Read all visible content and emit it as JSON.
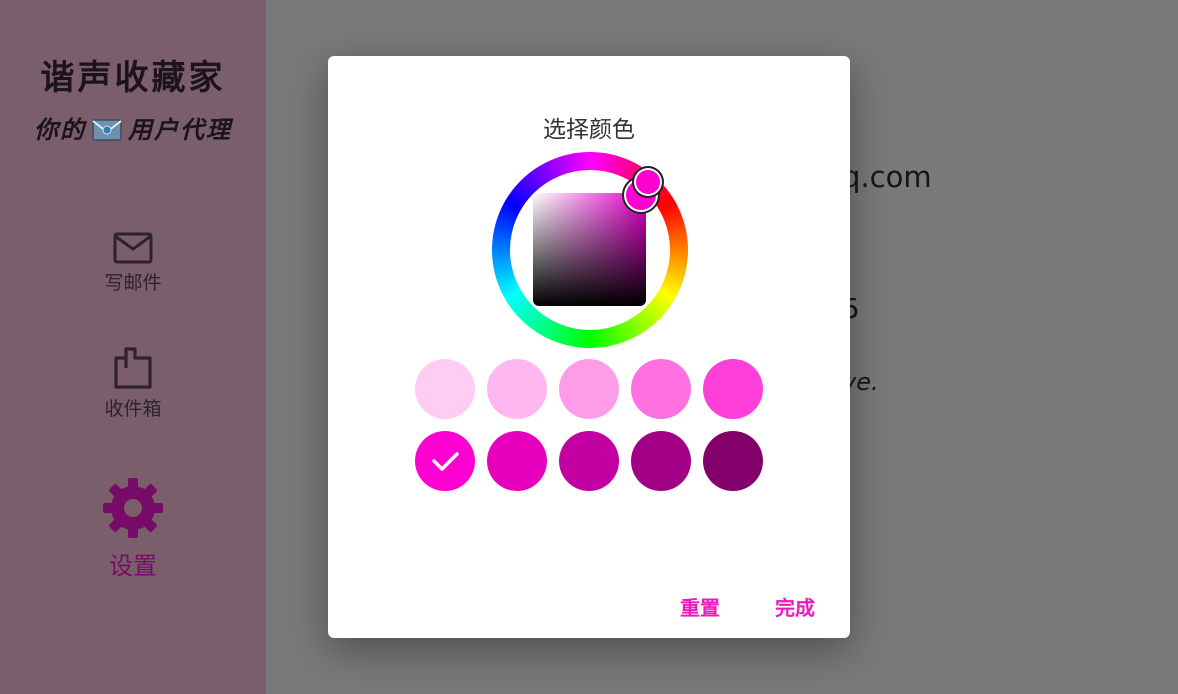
{
  "sidebar": {
    "app_title": "谐声收藏家",
    "subtitle_prefix": "你的",
    "subtitle_suffix": "用户代理",
    "items": [
      {
        "label": "写邮件",
        "icon": "mail-icon"
      },
      {
        "label": "收件箱",
        "icon": "inbox-icon"
      },
      {
        "label": "设置",
        "icon": "gear-icon",
        "active": true
      }
    ]
  },
  "background": {
    "email_fragment": "q.com",
    "number_fragment": "5",
    "note_fragment": "ve."
  },
  "dialog": {
    "title": "选择颜色",
    "selected_color": "#ff00d2",
    "swatches": [
      {
        "color": "#ffcdf4"
      },
      {
        "color": "#ffb8ef"
      },
      {
        "color": "#ff9ce8"
      },
      {
        "color": "#ff70e0"
      },
      {
        "color": "#ff3fd9"
      },
      {
        "color": "#ff00d2",
        "selected": true
      },
      {
        "color": "#e600bd"
      },
      {
        "color": "#c300a1"
      },
      {
        "color": "#a20086"
      },
      {
        "color": "#83006b"
      }
    ],
    "reset_label": "重置",
    "done_label": "完成"
  }
}
